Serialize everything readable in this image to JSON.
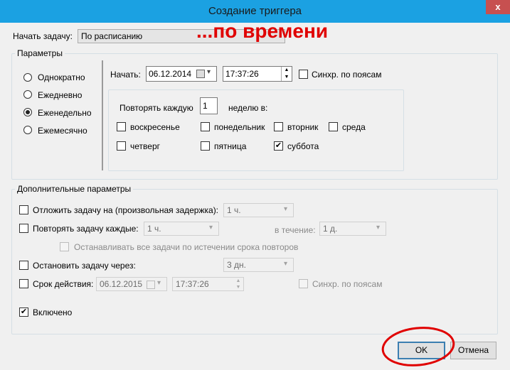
{
  "window": {
    "title": "Создание триггера",
    "close_glyph": "x"
  },
  "annotation": {
    "text": "...по времени",
    "color": "#e00000"
  },
  "begin_task": {
    "label": "Начать задачу:",
    "value": "По расписанию"
  },
  "settings": {
    "legend": "Параметры",
    "radios": [
      {
        "label": "Однократно",
        "checked": false
      },
      {
        "label": "Ежедневно",
        "checked": false
      },
      {
        "label": "Еженедельно",
        "checked": true
      },
      {
        "label": "Ежемесячно",
        "checked": false
      }
    ],
    "start_label": "Начать:",
    "start_date": "06.12.2014",
    "start_time": "17:37:26",
    "sync_tz_label": "Синхр. по поясам",
    "sync_tz_checked": false,
    "repeat_every_label": "Повторять каждую",
    "repeat_every_value": "1",
    "weeks_on_label": "неделю в:",
    "days": [
      {
        "label": "воскресенье",
        "checked": false
      },
      {
        "label": "понедельник",
        "checked": false
      },
      {
        "label": "вторник",
        "checked": false
      },
      {
        "label": "среда",
        "checked": false
      },
      {
        "label": "четверг",
        "checked": false
      },
      {
        "label": "пятница",
        "checked": false
      },
      {
        "label": "суббота",
        "checked": true
      }
    ]
  },
  "advanced": {
    "legend": "Дополнительные параметры",
    "delay_label": "Отложить задачу на (произвольная задержка):",
    "delay_value": "1 ч.",
    "repeat_label": "Повторять задачу каждые:",
    "repeat_value": "1 ч.",
    "duration_label": "в течение:",
    "duration_value": "1 д.",
    "stop_all_label": "Останавливать все задачи по истечении срока повторов",
    "stop_after_label": "Остановить задачу через:",
    "stop_after_value": "3 дн.",
    "expire_label": "Срок действия:",
    "expire_date": "06.12.2015",
    "expire_time": "17:37:26",
    "expire_sync_label": "Синхр. по поясам",
    "enabled_label": "Включено",
    "enabled_checked": true
  },
  "buttons": {
    "ok": "OK",
    "cancel": "Отмена"
  },
  "icons": {
    "calendar": "calendar-icon",
    "dropdown": "chevron-down-icon",
    "spin": "spin-arrows-icon",
    "check": "✔"
  },
  "colors": {
    "titlebar": "#1ba1e2",
    "close": "#c75050",
    "highlight_circle": "#e00000"
  }
}
